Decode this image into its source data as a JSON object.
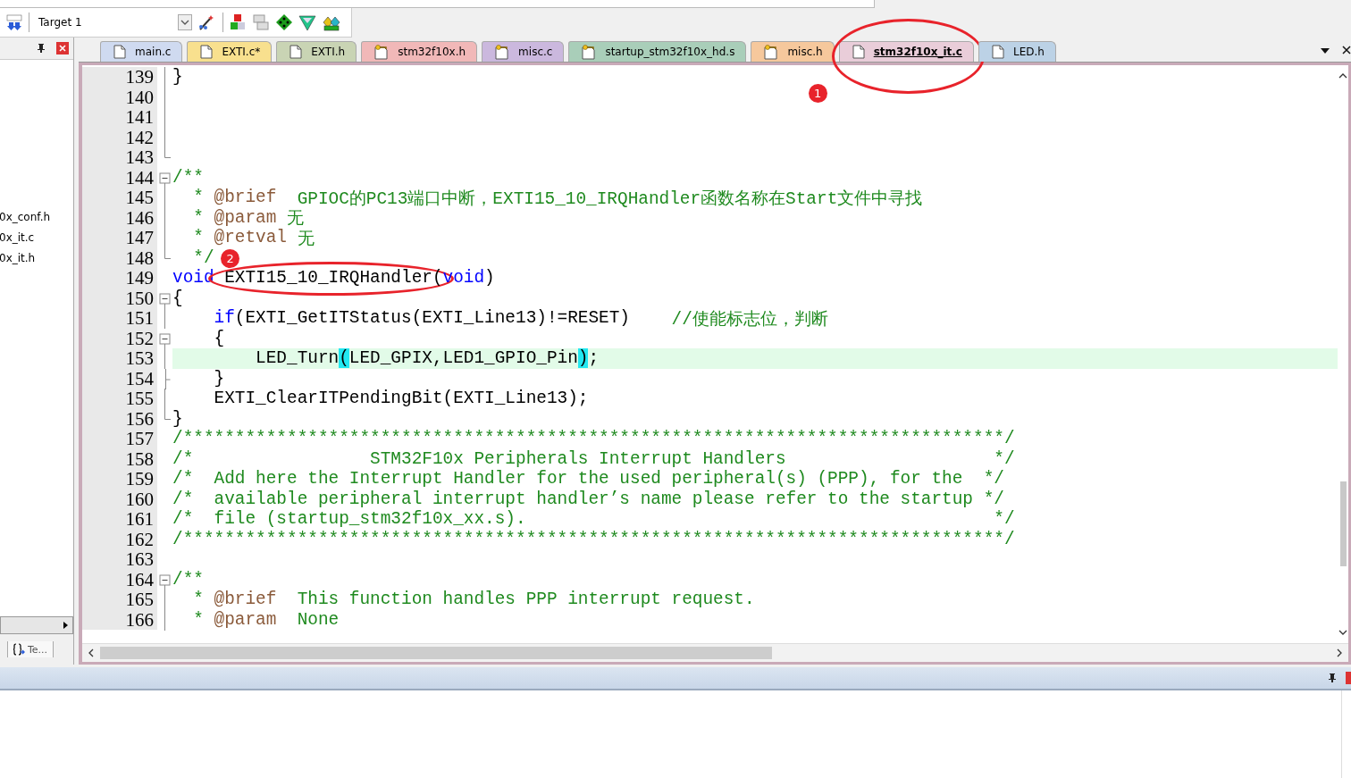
{
  "toolbar": {
    "target": "Target 1"
  },
  "left_panel": {
    "files": [
      "0x_conf.h",
      "0x_it.c",
      "0x_it.h"
    ],
    "bottom_tab": "Te..."
  },
  "tabs": [
    {
      "label": "main.c",
      "kind": "file",
      "color": "#cfdaf0",
      "selected": false
    },
    {
      "label": "EXTI.c*",
      "kind": "file",
      "color": "#f8e08e",
      "selected": false
    },
    {
      "label": "EXTI.h",
      "kind": "file",
      "color": "#c9d4b4",
      "selected": false
    },
    {
      "label": "stm32f10x.h",
      "kind": "keyfile",
      "color": "#f1b8b8",
      "selected": false
    },
    {
      "label": "misc.c",
      "kind": "keyfile",
      "color": "#cbb8de",
      "selected": false
    },
    {
      "label": "startup_stm32f10x_hd.s",
      "kind": "keyfile",
      "color": "#a9ceb9",
      "selected": false
    },
    {
      "label": "misc.h",
      "kind": "keyfile",
      "color": "#f6c89c",
      "selected": false
    },
    {
      "label": "stm32f10x_it.c",
      "kind": "file",
      "color": "#e9cdd9",
      "selected": true,
      "callout": "1"
    },
    {
      "label": "LED.h",
      "kind": "file",
      "color": "#bcd2e6",
      "selected": false
    }
  ],
  "editor": {
    "lines": [
      {
        "number": "139",
        "fold": {
          "kind": "line"
        },
        "highlighted": false,
        "tokens": [
          {
            "kind": "plain",
            "text": "}"
          }
        ]
      },
      {
        "number": "140",
        "fold": {
          "kind": "line"
        },
        "highlighted": false
      },
      {
        "number": "141",
        "fold": {
          "kind": "line"
        },
        "highlighted": false
      },
      {
        "number": "142",
        "fold": {
          "kind": "line"
        },
        "highlighted": false
      },
      {
        "number": "143",
        "fold": {
          "kind": "end"
        },
        "highlighted": false
      },
      {
        "number": "144",
        "fold": {
          "kind": "open"
        },
        "highlighted": false,
        "tokens": [
          {
            "kind": "comment",
            "text": "/**"
          }
        ]
      },
      {
        "number": "145",
        "fold": {
          "kind": "line"
        },
        "highlighted": false,
        "tokens": [
          {
            "kind": "comment",
            "text": "  * "
          },
          {
            "kind": "tag",
            "text": "@brief"
          },
          {
            "kind": "comment",
            "text": "  GPIOC的PC13端口中断，EXTI15_10_IRQHandler函数名称在Start文件中寻找"
          }
        ]
      },
      {
        "number": "146",
        "fold": {
          "kind": "line"
        },
        "highlighted": false,
        "tokens": [
          {
            "kind": "comment",
            "text": "  * "
          },
          {
            "kind": "tag",
            "text": "@param"
          },
          {
            "kind": "comment",
            "text": " 无"
          }
        ]
      },
      {
        "number": "147",
        "fold": {
          "kind": "line"
        },
        "highlighted": false,
        "tokens": [
          {
            "kind": "comment",
            "text": "  * "
          },
          {
            "kind": "tag",
            "text": "@retval"
          },
          {
            "kind": "comment",
            "text": " 无"
          }
        ]
      },
      {
        "number": "148",
        "fold": {
          "kind": "end"
        },
        "highlighted": false,
        "tokens": [
          {
            "kind": "comment",
            "text": "  */"
          }
        ]
      },
      {
        "number": "149",
        "highlighted": false,
        "tokens": [
          {
            "kind": "keyword",
            "text": "void "
          },
          {
            "kind": "plain",
            "text": "EXTI15_10_IRQHandler",
            "callout": "2"
          },
          {
            "kind": "plain",
            "text": "("
          },
          {
            "kind": "keyword",
            "text": "void"
          },
          {
            "kind": "plain",
            "text": ")"
          }
        ]
      },
      {
        "number": "150",
        "fold": {
          "kind": "open"
        },
        "highlighted": false,
        "tokens": [
          {
            "kind": "plain",
            "text": "{"
          }
        ]
      },
      {
        "number": "151",
        "fold": {
          "kind": "line"
        },
        "highlighted": false,
        "tokens": [
          {
            "kind": "keyword",
            "text": "    if"
          },
          {
            "kind": "plain",
            "text": "(EXTI_GetITStatus(EXTI_Line13)!=RESET)    "
          },
          {
            "kind": "comment",
            "text": "//使能标志位，判断"
          }
        ]
      },
      {
        "number": "152",
        "fold": {
          "kind": "open"
        },
        "highlighted": false,
        "tokens": [
          {
            "kind": "plain",
            "text": "    {"
          }
        ]
      },
      {
        "number": "153",
        "fold": {
          "kind": "line"
        },
        "highlighted": true,
        "tokens": [
          {
            "kind": "plain",
            "text": "        LED_Turn"
          },
          {
            "kind": "match",
            "text": "("
          },
          {
            "kind": "plain",
            "text": "LED_GPIX,LED1_GPIO_Pin"
          },
          {
            "kind": "match",
            "text": ")"
          },
          {
            "kind": "plain",
            "text": ";"
          }
        ]
      },
      {
        "number": "154",
        "fold": {
          "kind": "tick"
        },
        "highlighted": false,
        "tokens": [
          {
            "kind": "plain",
            "text": "    }"
          }
        ]
      },
      {
        "number": "155",
        "fold": {
          "kind": "line"
        },
        "highlighted": false,
        "tokens": [
          {
            "kind": "plain",
            "text": "    EXTI_ClearITPendingBit(EXTI_Line13);"
          }
        ]
      },
      {
        "number": "156",
        "fold": {
          "kind": "end"
        },
        "highlighted": false,
        "tokens": [
          {
            "kind": "plain",
            "text": "}"
          }
        ]
      },
      {
        "number": "157",
        "highlighted": false,
        "tokens": [
          {
            "kind": "comment",
            "text": "/*******************************************************************************/"
          }
        ]
      },
      {
        "number": "158",
        "highlighted": false,
        "tokens": [
          {
            "kind": "comment",
            "text": "/*                 STM32F10x Peripherals Interrupt Handlers                    */"
          }
        ]
      },
      {
        "number": "159",
        "highlighted": false,
        "tokens": [
          {
            "kind": "comment",
            "text": "/*  Add here the Interrupt Handler for the used peripheral(s) (PPP), for the  */"
          }
        ]
      },
      {
        "number": "160",
        "highlighted": false,
        "tokens": [
          {
            "kind": "comment",
            "text": "/*  available peripheral interrupt handler’s name please refer to the startup */"
          }
        ]
      },
      {
        "number": "161",
        "highlighted": false,
        "tokens": [
          {
            "kind": "comment",
            "text": "/*  file (startup_stm32f10x_xx.s).                                             */"
          }
        ]
      },
      {
        "number": "162",
        "highlighted": false,
        "tokens": [
          {
            "kind": "comment",
            "text": "/*******************************************************************************/"
          }
        ]
      },
      {
        "number": "163",
        "highlighted": false
      },
      {
        "number": "164",
        "fold": {
          "kind": "open"
        },
        "highlighted": false,
        "tokens": [
          {
            "kind": "comment",
            "text": "/**"
          }
        ]
      },
      {
        "number": "165",
        "fold": {
          "kind": "line"
        },
        "highlighted": false,
        "tokens": [
          {
            "kind": "comment",
            "text": "  * "
          },
          {
            "kind": "tag",
            "text": "@brief"
          },
          {
            "kind": "comment",
            "text": "  This function handles PPP interrupt request."
          }
        ]
      },
      {
        "number": "166",
        "fold": {
          "kind": "line"
        },
        "highlighted": false,
        "tokens": [
          {
            "kind": "comment",
            "text": "  * "
          },
          {
            "kind": "tag",
            "text": "@param"
          },
          {
            "kind": "comment",
            "text": "  None"
          }
        ]
      }
    ]
  }
}
